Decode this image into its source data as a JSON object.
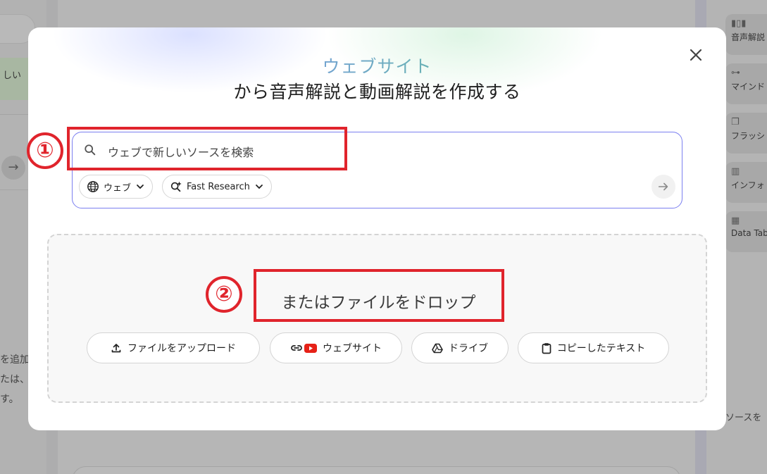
{
  "modal": {
    "title_accent": "ウェブサイト",
    "title_main": "から音声解説と動画解説を作成する",
    "close_label": "×"
  },
  "search": {
    "placeholder": "ウェブで新しいソースを検索",
    "source_chip": "ウェブ",
    "mode_chip": "Fast Research",
    "send_icon": "arrow-right-icon"
  },
  "dropzone": {
    "text": "またはファイルをドロップ",
    "buttons": [
      {
        "label": "ファイルをアップロード",
        "icon": "upload-icon"
      },
      {
        "label": "ウェブサイト",
        "icon": "link-youtube-icon"
      },
      {
        "label": "ドライブ",
        "icon": "drive-icon"
      },
      {
        "label": "コピーしたテキスト",
        "icon": "clipboard-icon"
      }
    ]
  },
  "annotations": [
    "①",
    "②"
  ],
  "background": {
    "left_green_text": "しい",
    "left_texts": [
      "を追加",
      "たは、",
      "す。"
    ],
    "studio_items": [
      "音声解説",
      "マインド",
      "フラッシ",
      "インフォ",
      "Data Tab"
    ],
    "right_footer": "ソースを"
  },
  "colors": {
    "accent_border": "#7b7ff0",
    "annotation_red": "#e0242c",
    "title_gradient_start": "#7d8ef6",
    "title_gradient_end": "#5fc78f"
  }
}
